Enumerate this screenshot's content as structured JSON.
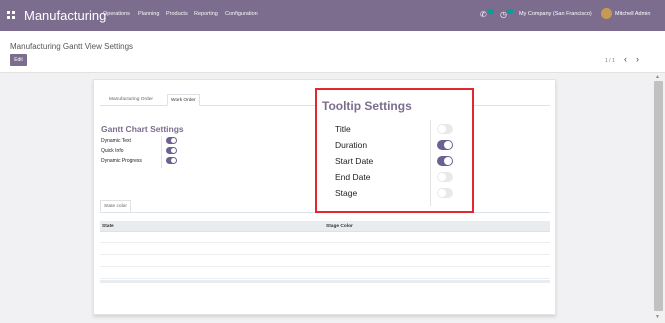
{
  "navbar": {
    "app_title": "Manufacturing",
    "menu": [
      "Operations",
      "Planning",
      "Products",
      "Reporting",
      "Configuration"
    ],
    "company": "My Company (San Francisco)",
    "user": "Mitchell Admin"
  },
  "control": {
    "breadcrumb": "Manufacturing Gantt View Settings",
    "edit_label": "Edit",
    "pager": "1 / 1",
    "prev": "‹",
    "next": "›"
  },
  "form": {
    "tabs": [
      "Manufacturing Order",
      "Work Order"
    ],
    "active_tab": "Work Order",
    "section_title": "Gantt Chart Settings",
    "fields": [
      {
        "label": "Dynamic Text",
        "on": true
      },
      {
        "label": "Quick Info",
        "on": true
      },
      {
        "label": "Dynamic Progress",
        "on": true
      }
    ],
    "state_tab": "State color",
    "table_headers": [
      "State",
      "Stage Color"
    ]
  },
  "tooltip": {
    "title": "Tooltip Settings",
    "fields": [
      {
        "label": "Title",
        "on": false
      },
      {
        "label": "Duration",
        "on": true
      },
      {
        "label": "Start Date",
        "on": true
      },
      {
        "label": "End Date",
        "on": false
      },
      {
        "label": "Stage",
        "on": false
      }
    ]
  },
  "colors": {
    "brand": "#7c6d8e",
    "toggle_on": "#6d6092",
    "highlight": "#e3262f"
  }
}
